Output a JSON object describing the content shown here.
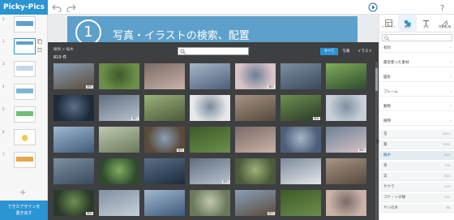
{
  "app": {
    "logo": "Picky-Pics"
  },
  "toolbar": {
    "undo_icon": "undo-icon",
    "redo_icon": "redo-icon",
    "play_icon": "play-icon",
    "help_icon": "help-icon"
  },
  "slides": {
    "numbers": [
      "1",
      "2",
      "3",
      "4",
      "5",
      "6",
      "7"
    ],
    "add_label": "+",
    "export_label_line1": "できたデザインを",
    "export_label_line2": "書き出す"
  },
  "canvas": {
    "slide_number": "1",
    "slide_title": "写真・イラストの検索、配置"
  },
  "modal": {
    "breadcrumb": "植物 > 植木",
    "count": "819 件",
    "search_value": "",
    "filters": [
      "すべて",
      "写真",
      "イラスト"
    ],
    "active_filter": "すべて",
    "badge_label": "無料"
  },
  "right_panel": {
    "tabs": [
      "レイアウト",
      "素材",
      "文字",
      "背景色/線"
    ],
    "active_tab": "素材",
    "categories": [
      "有料",
      "最近使った素材",
      "図形",
      "フレーム",
      "動物",
      "植物"
    ],
    "subcategories": [
      {
        "label": "花",
        "count": "2613"
      },
      {
        "label": "葉",
        "count": "1301"
      },
      {
        "label": "植木",
        "count": "819"
      },
      {
        "label": "草",
        "count": "718"
      },
      {
        "label": "実",
        "count": "615"
      },
      {
        "label": "サクラ",
        "count": "474"
      },
      {
        "label": "コケ・シダ類",
        "count": "122"
      },
      {
        "label": "ヤシの木",
        "count": "88"
      }
    ],
    "selected_sub": "植木"
  },
  "colors": {
    "accent": "#2b94d3",
    "modal_bg": "#3e3f41",
    "slide_header": "#5da0cb"
  }
}
